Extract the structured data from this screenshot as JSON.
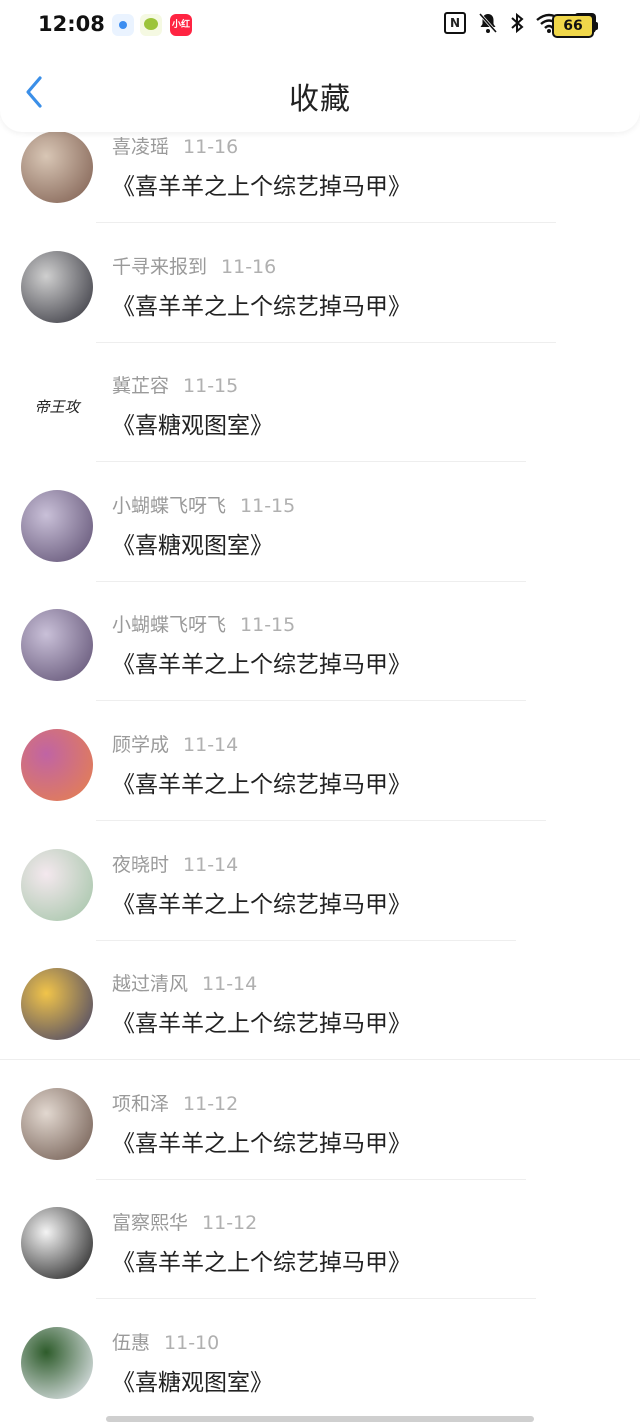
{
  "status_bar": {
    "time": "12:08",
    "apps": [
      "app-icon",
      "app-icon",
      "xiaohongshu-icon"
    ],
    "xiaohongshu_label": "小红书",
    "battery": "66",
    "icons": [
      "nfc-icon",
      "bell-off-icon",
      "bluetooth-icon",
      "wifi-icon",
      "x-box-icon",
      "battery-icon"
    ]
  },
  "header": {
    "title": "收藏",
    "back_icon": "chevron-left-icon",
    "accent_color": "#3b8fe8"
  },
  "favorites": [
    {
      "name": "喜凌瑶",
      "date": "11-16",
      "work": "《喜羊羊之上个综艺掉马甲》",
      "avatar_colors": [
        "#d8c6b5",
        "#7b5a4c"
      ]
    },
    {
      "name": "千寻来报到",
      "date": "11-16",
      "work": "《喜羊羊之上个综艺掉马甲》",
      "avatar_colors": [
        "#cfcfcf",
        "#2d2d36"
      ]
    },
    {
      "name": "冀芷容",
      "date": "11-15",
      "work": "《喜糖观图室》",
      "avatar_colors": [
        "#ffffff",
        "#222222"
      ],
      "avatar_text": "帝王攻"
    },
    {
      "name": "小蝴蝶飞呀飞",
      "date": "11-15",
      "work": "《喜糖观图室》",
      "avatar_colors": [
        "#c9c0d8",
        "#5a4b6e"
      ]
    },
    {
      "name": "小蝴蝶飞呀飞",
      "date": "11-15",
      "work": "《喜羊羊之上个综艺掉马甲》",
      "avatar_colors": [
        "#c9c0d8",
        "#5a4b6e"
      ]
    },
    {
      "name": "顾学成",
      "date": "11-14",
      "work": "《喜羊羊之上个综艺掉马甲》",
      "avatar_colors": [
        "#c064a4",
        "#e8824a"
      ]
    },
    {
      "name": "夜晓时",
      "date": "11-14",
      "work": "《喜羊羊之上个综艺掉马甲》",
      "avatar_colors": [
        "#f4e8ee",
        "#9fc3a4"
      ]
    },
    {
      "name": "越过清风",
      "date": "11-14",
      "work": "《喜羊羊之上个综艺掉马甲》",
      "avatar_colors": [
        "#f1c44a",
        "#3c3c6a"
      ]
    },
    {
      "name": "项和泽",
      "date": "11-12",
      "work": "《喜羊羊之上个综艺掉马甲》",
      "avatar_colors": [
        "#e2d8d0",
        "#6a5449"
      ]
    },
    {
      "name": "富察熙华",
      "date": "11-12",
      "work": "《喜羊羊之上个综艺掉马甲》",
      "avatar_colors": [
        "#f4f4f4",
        "#111111"
      ]
    },
    {
      "name": "伍惠",
      "date": "11-10",
      "work": "《喜糖观图室》",
      "avatar_colors": [
        "#2e5c2b",
        "#f4f4ff"
      ]
    }
  ]
}
